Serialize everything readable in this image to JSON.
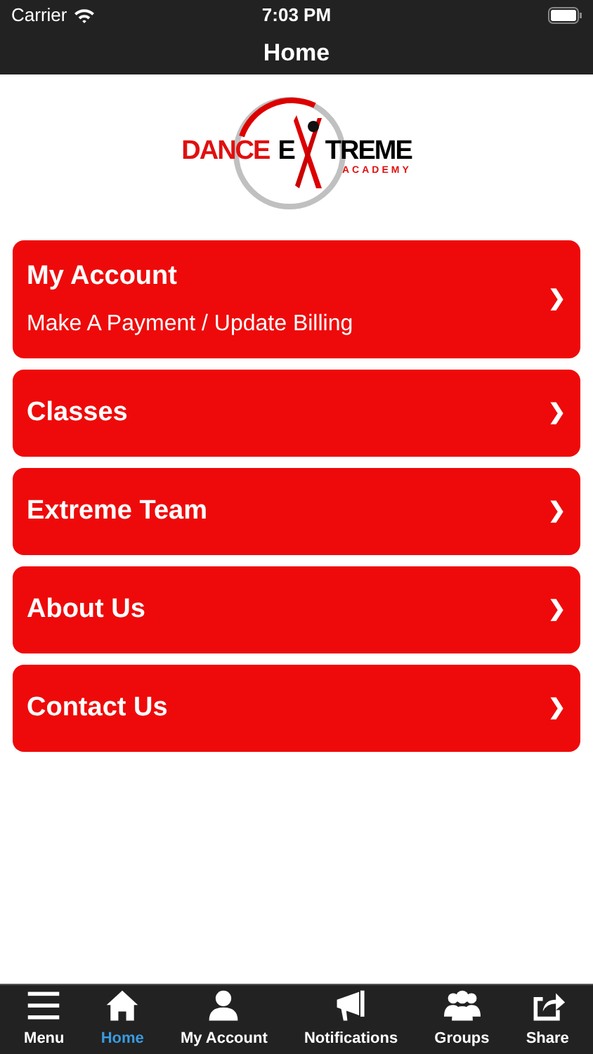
{
  "status_bar": {
    "carrier": "Carrier",
    "time": "7:03 PM"
  },
  "nav_bar": {
    "title": "Home"
  },
  "logo": {
    "word_1": "DANCE",
    "word_2_start": "E",
    "word_2_end": "TREME",
    "tagline": "ACADEMY"
  },
  "menu_items": [
    {
      "title": "My Account",
      "subtitle": "Make A Payment / Update Billing",
      "chevron": "❯"
    },
    {
      "title": "Classes",
      "chevron": "❯"
    },
    {
      "title": "Extreme Team",
      "chevron": "❯"
    },
    {
      "title": "About Us",
      "chevron": "❯"
    },
    {
      "title": "Contact Us",
      "chevron": "❯"
    }
  ],
  "tab_bar": [
    {
      "kind": "menu",
      "label": "Menu",
      "selected": false
    },
    {
      "kind": "home",
      "label": "Home",
      "selected": true
    },
    {
      "kind": "account",
      "label": "My Account",
      "selected": false
    },
    {
      "kind": "notifications",
      "label": "Notifications",
      "selected": false
    },
    {
      "kind": "groups",
      "label": "Groups",
      "selected": false
    },
    {
      "kind": "share",
      "label": "Share",
      "selected": false
    }
  ]
}
